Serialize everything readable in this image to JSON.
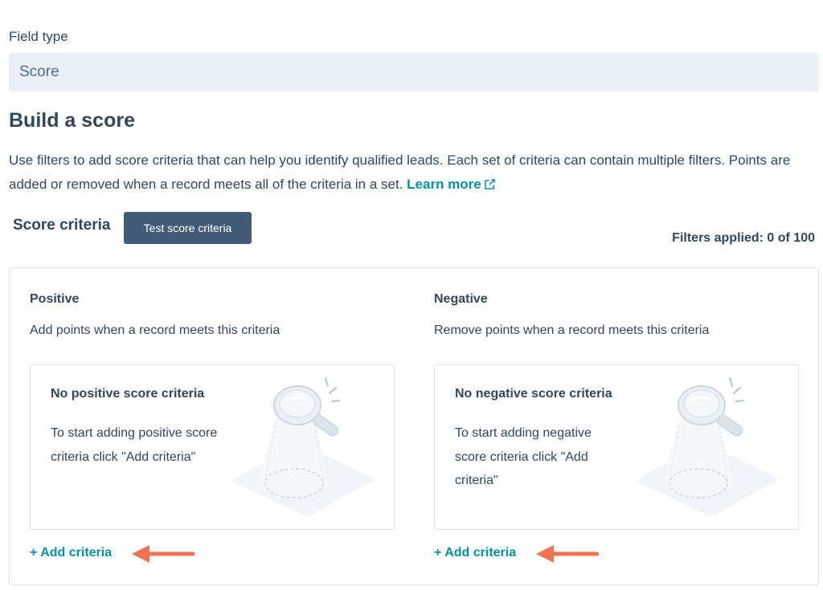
{
  "field_type": {
    "label": "Field type",
    "value": "Score"
  },
  "page_title": "Build a score",
  "description": {
    "text": "Use filters to add score criteria that can help you identify qualified leads. Each set of criteria can contain multiple filters. Points are added or removed when a record meets all of the criteria in a set. ",
    "link": "Learn more"
  },
  "score_criteria": {
    "label": "Score criteria",
    "test_button": "Test score criteria",
    "filters_applied": "Filters applied: 0 of 100"
  },
  "positive": {
    "title": "Positive",
    "subtitle": "Add points when a record meets this criteria",
    "empty_title": "No positive score criteria",
    "empty_body": "To start adding positive score criteria click \"Add criteria\"",
    "add_link": "+ Add criteria"
  },
  "negative": {
    "title": "Negative",
    "subtitle": "Remove points when a record meets this criteria",
    "empty_title": "No negative score criteria",
    "empty_body": "To start adding negative score criteria click \"Add criteria\"",
    "add_link": "+ Add criteria"
  },
  "colors": {
    "link": "#0091ae",
    "button": "#425b76",
    "annotation_arrow": "#f2714f",
    "select_bg": "#eaf0f6"
  },
  "icons": [
    "external-link-icon",
    "magnifying-glass-illustration",
    "arrow-annotation"
  ]
}
